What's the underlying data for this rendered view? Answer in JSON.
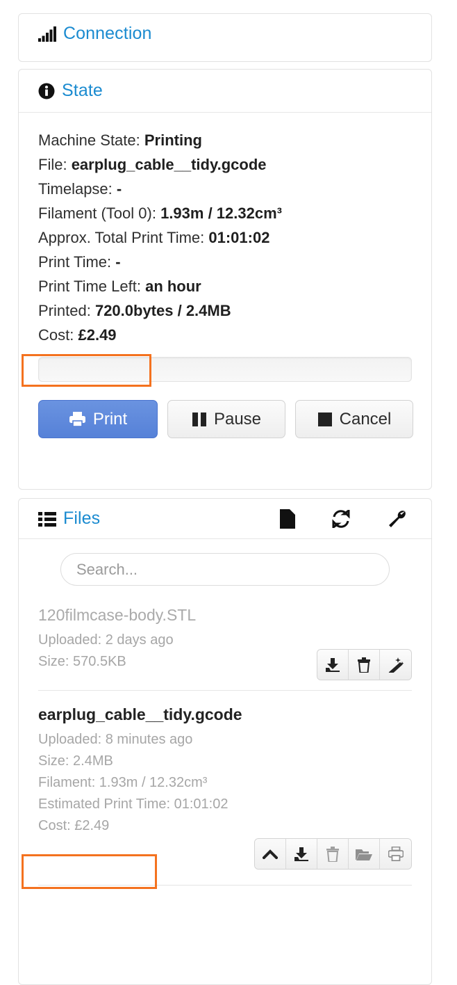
{
  "theme": {
    "link_blue": "#1b8bd0",
    "primary_button": "#5681d8",
    "highlight_orange": "#f4721f",
    "muted_text": "#a6a6a6"
  },
  "connection_panel": {
    "icon": "signal-bars-icon",
    "title": "Connection"
  },
  "state_panel": {
    "icon": "info-circle-icon",
    "title": "State",
    "lines": [
      {
        "label": "Machine State:",
        "value": "Printing"
      },
      {
        "label": "File:",
        "value": "earplug_cable__tidy.gcode"
      },
      {
        "label": "Timelapse:",
        "value": "-"
      },
      {
        "label": "Filament (Tool 0):",
        "value": "1.93m / 12.32cm³"
      },
      {
        "label": "Approx. Total Print Time:",
        "value": "01:01:02"
      },
      {
        "label": "Print Time:",
        "value": "-"
      },
      {
        "label": "Print Time Left:",
        "value": "an hour"
      },
      {
        "label": "Printed:",
        "value": "720.0bytes / 2.4MB"
      },
      {
        "label": "Cost:",
        "value": "£2.49"
      }
    ],
    "progress": {
      "percent": 0,
      "text": ""
    },
    "buttons": {
      "print": "Print",
      "pause": "Pause",
      "cancel": "Cancel"
    }
  },
  "files_panel": {
    "icon": "list-icon",
    "title": "Files",
    "header_actions": [
      {
        "name": "file-icon",
        "label": ""
      },
      {
        "name": "refresh-icon",
        "label": ""
      },
      {
        "name": "wrench-icon",
        "label": ""
      }
    ],
    "search": {
      "placeholder": "Search...",
      "value": ""
    },
    "files": [
      {
        "name": "120filmcase-body.STL",
        "state": "inactive",
        "meta": [
          "Uploaded: 2 days ago",
          "Size: 570.5KB"
        ],
        "actions": [
          "download-icon",
          "trash-icon",
          "magic-wand-icon"
        ]
      },
      {
        "name": "earplug_cable__tidy.gcode",
        "state": "active",
        "meta": [
          "Uploaded: 8 minutes ago",
          "Size: 2.4MB",
          "Filament: 1.93m / 12.32cm³",
          "Estimated Print Time: 01:01:02",
          "Cost: £2.49"
        ],
        "actions": [
          "chevron-up-icon",
          "download-icon",
          "trash-icon",
          "folder-open-icon",
          "print-icon"
        ]
      }
    ]
  },
  "annotations": [
    {
      "name": "highlight-state-cost",
      "target": "Cost: £2.49"
    },
    {
      "name": "highlight-file-cost",
      "target": "Cost: £2.49"
    }
  ]
}
